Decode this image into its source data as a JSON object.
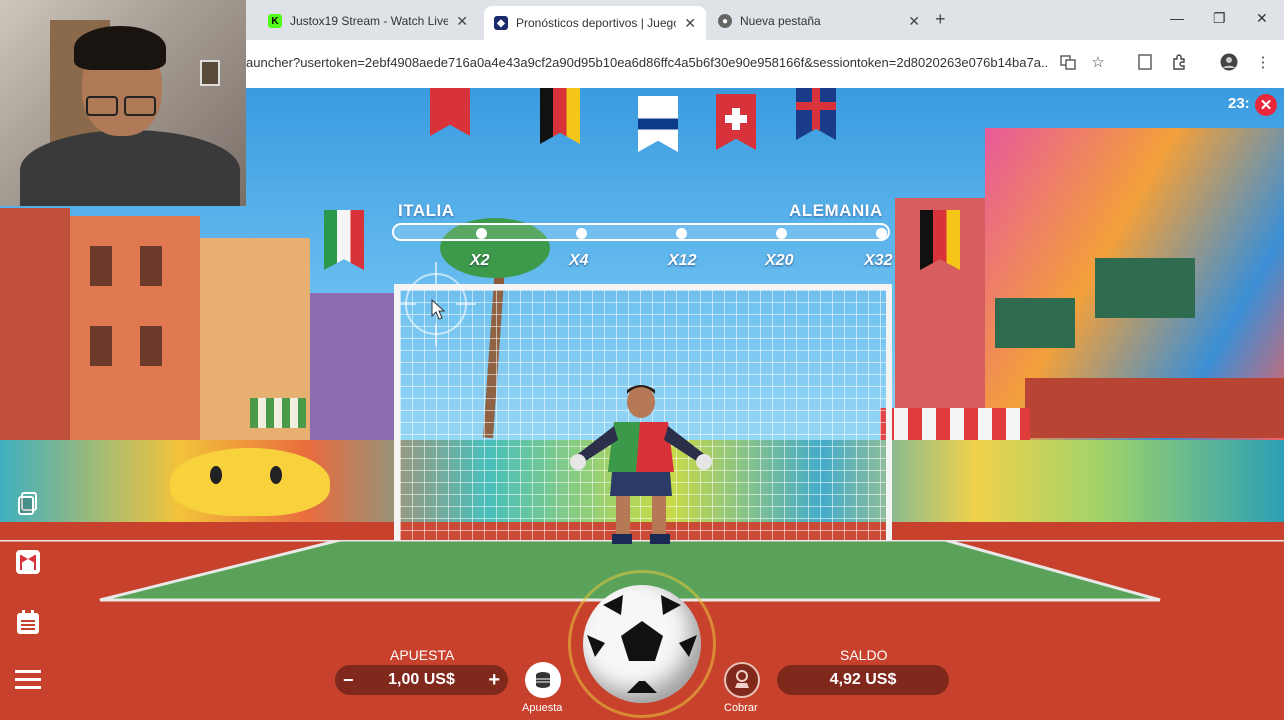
{
  "browser": {
    "tabs": [
      {
        "title": "Justox19 Stream - Watch Live o",
        "icon": "kick-icon",
        "active": false
      },
      {
        "title": "Pronósticos deportivos | Juego",
        "icon": "sports-icon",
        "active": true
      },
      {
        "title": "Nueva pestaña",
        "icon": "chrome-icon",
        "active": false
      }
    ],
    "url": "auncher?usertoken=2ebf4908aede716a0a4e43a9cf2a90d95b10ea6d86ffc4a5b6f30e90e958166f&sessiontoken=2d8020263e076b14ba7a..."
  },
  "game": {
    "team_left": "ITALIA",
    "team_right": "ALEMANIA",
    "multipliers": [
      "X2",
      "X4",
      "X12",
      "X20",
      "X32"
    ],
    "timer": "23:",
    "apuesta": {
      "label": "APUESTA",
      "value": "1,00 US$",
      "minus": "−",
      "plus": "+"
    },
    "saldo": {
      "label": "SALDO",
      "value": "4,92 US$"
    },
    "apuesta_button_label": "Apuesta",
    "cobrar_button_label": "Cobrar",
    "colors": {
      "accent_red": "#e8283a",
      "pitch_red": "#c8412c",
      "pitch_green": "#5aa25a"
    }
  }
}
